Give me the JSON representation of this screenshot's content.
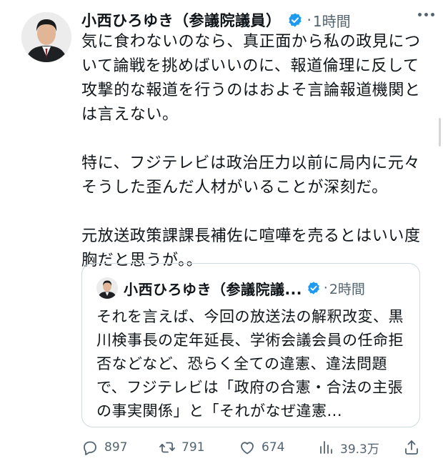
{
  "tweet": {
    "author_name": "小西ひろゆき（参議院議員）",
    "separator": "·",
    "time": "1時間",
    "paragraphs": [
      "気に食わないのなら、真正面から私の政見について論戦を挑めばいいのに、報道倫理に反して攻撃的な報道を行うのはおよそ言論報道機関とは言えない。",
      "特に、フジテレビは政治圧力以前に局内に元々そうした歪んだ人材がいることが深刻だ。",
      "元放送政策課課長補佐に喧嘩を売るとはいい度胸だと思うが。。"
    ]
  },
  "quoted_tweet": {
    "author_name": "小西ひろゆき（参議院議...",
    "separator": "·",
    "time": "2時間",
    "text": "それを言えば、今回の放送法の解釈改変、黒川検事長の定年延長、学術会議会員の任命拒否などなど、恐らく全ての違憲、違法問題で、フジテレビは「政府の合憲・合法の主張の事実関係」と「それがなぜ違憲..."
  },
  "actions": {
    "reply_count": "897",
    "retweet_count": "791",
    "like_count": "674",
    "views_count": "39.3万"
  },
  "colors": {
    "verified": "#1d9bf0",
    "secondary_text": "#536471",
    "border": "#cfd9de"
  },
  "icons": [
    "verified-badge-icon",
    "more-icon",
    "reply-icon",
    "retweet-icon",
    "like-icon",
    "views-icon",
    "share-icon"
  ]
}
